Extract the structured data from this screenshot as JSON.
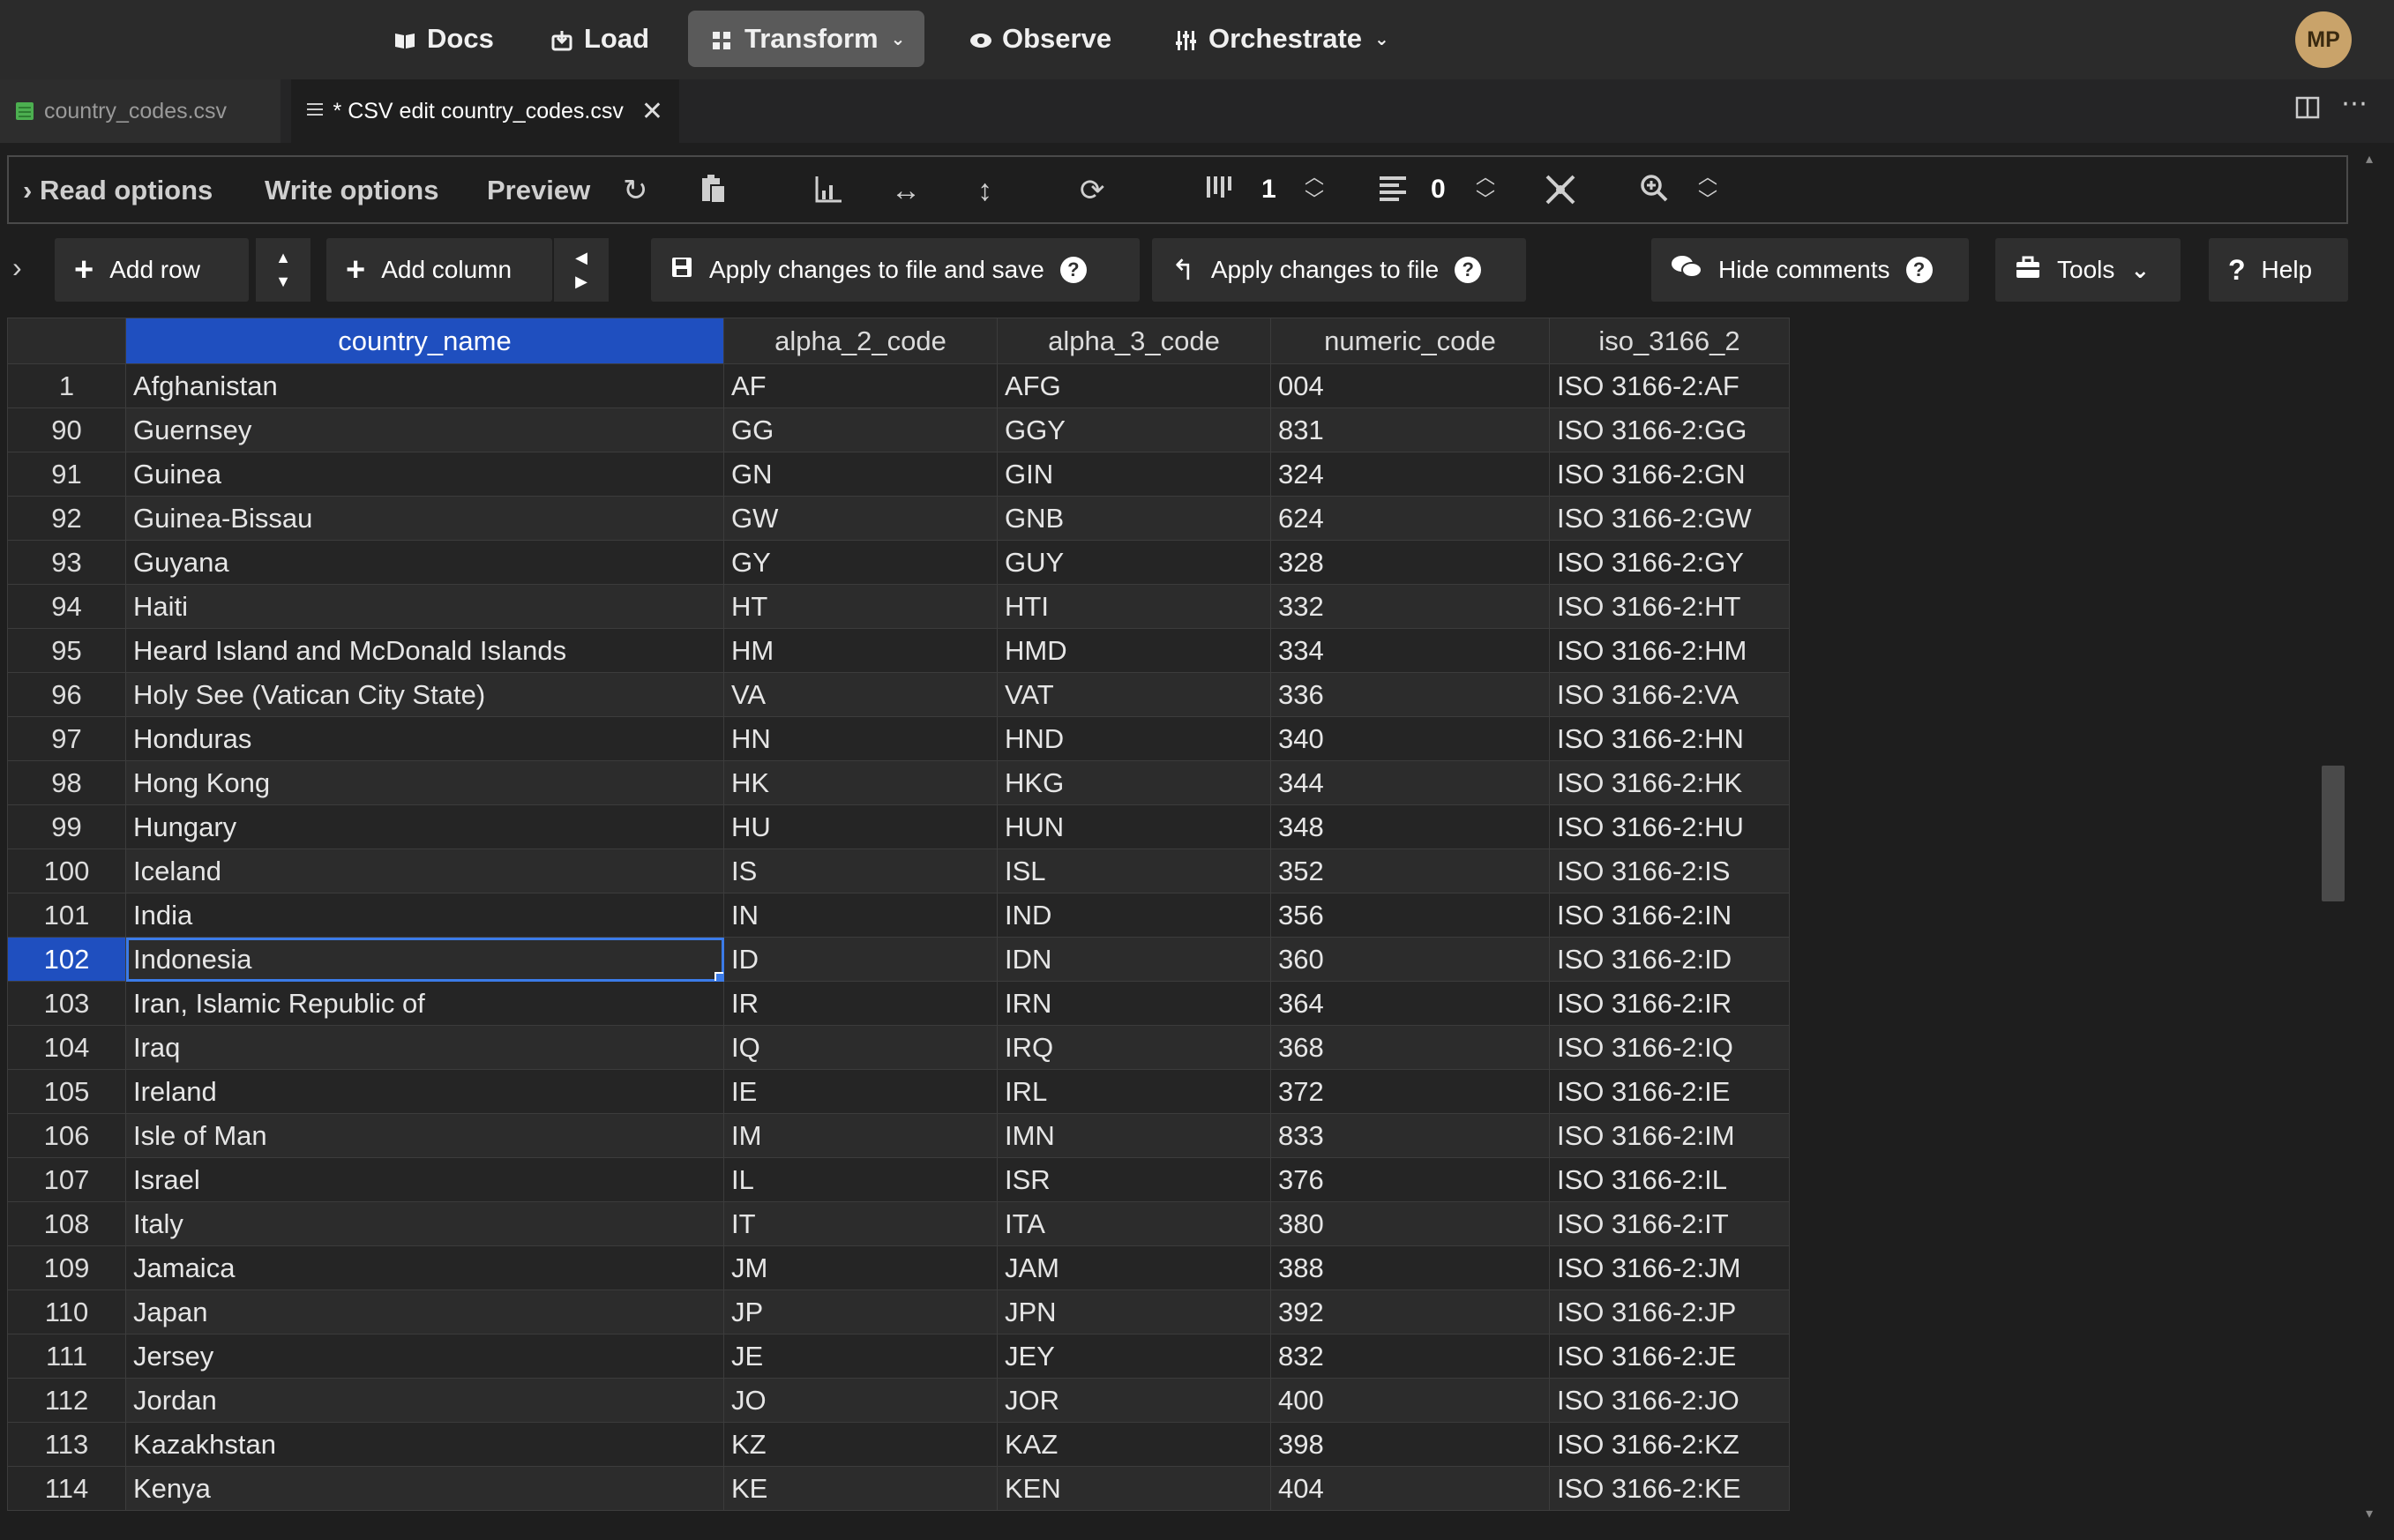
{
  "nav": {
    "items": [
      {
        "label": "Docs",
        "icon": "book-icon"
      },
      {
        "label": "Load",
        "icon": "load-icon"
      },
      {
        "label": "Transform",
        "icon": "transform-icon",
        "active": true,
        "caret": "⌄"
      },
      {
        "label": "Observe",
        "icon": "eye-icon"
      },
      {
        "label": "Orchestrate",
        "icon": "orchestrate-icon",
        "caret": "⌄"
      }
    ],
    "avatar": "MP"
  },
  "tabs": [
    {
      "label": "country_codes.csv",
      "active": false
    },
    {
      "label": "* CSV edit country_codes.csv",
      "active": true,
      "close": "✕"
    }
  ],
  "toolbar1": {
    "read_options": "Read options",
    "write_options": "Write options",
    "preview": "Preview",
    "fixed_columns_value": "1",
    "fixed_rows_value": "0"
  },
  "toolbar2": {
    "add_row": "Add row",
    "add_column": "Add column",
    "apply_save": "Apply changes to file and save",
    "apply": "Apply changes to file",
    "hide_comments": "Hide comments",
    "tools": "Tools",
    "help": "Help"
  },
  "colors": {
    "selection": "#1f4fbf",
    "accent": "#3b7be8",
    "avatar": "#c9a36a"
  },
  "table": {
    "columns": [
      "country_name",
      "alpha_2_code",
      "alpha_3_code",
      "numeric_code",
      "iso_3166_2"
    ],
    "selected_column": "country_name",
    "selected_row": "102",
    "rows": [
      [
        "1",
        "Afghanistan",
        "AF",
        "AFG",
        "004",
        "ISO 3166-2:AF"
      ],
      [
        "90",
        "Guernsey",
        "GG",
        "GGY",
        "831",
        "ISO 3166-2:GG"
      ],
      [
        "91",
        "Guinea",
        "GN",
        "GIN",
        "324",
        "ISO 3166-2:GN"
      ],
      [
        "92",
        "Guinea-Bissau",
        "GW",
        "GNB",
        "624",
        "ISO 3166-2:GW"
      ],
      [
        "93",
        "Guyana",
        "GY",
        "GUY",
        "328",
        "ISO 3166-2:GY"
      ],
      [
        "94",
        "Haiti",
        "HT",
        "HTI",
        "332",
        "ISO 3166-2:HT"
      ],
      [
        "95",
        "Heard Island and McDonald Islands",
        "HM",
        "HMD",
        "334",
        "ISO 3166-2:HM"
      ],
      [
        "96",
        "Holy See (Vatican City State)",
        "VA",
        "VAT",
        "336",
        "ISO 3166-2:VA"
      ],
      [
        "97",
        "Honduras",
        "HN",
        "HND",
        "340",
        "ISO 3166-2:HN"
      ],
      [
        "98",
        "Hong Kong",
        "HK",
        "HKG",
        "344",
        "ISO 3166-2:HK"
      ],
      [
        "99",
        "Hungary",
        "HU",
        "HUN",
        "348",
        "ISO 3166-2:HU"
      ],
      [
        "100",
        "Iceland",
        "IS",
        "ISL",
        "352",
        "ISO 3166-2:IS"
      ],
      [
        "101",
        "India",
        "IN",
        "IND",
        "356",
        "ISO 3166-2:IN"
      ],
      [
        "102",
        "Indonesia",
        "ID",
        "IDN",
        "360",
        "ISO 3166-2:ID"
      ],
      [
        "103",
        "Iran, Islamic Republic of",
        "IR",
        "IRN",
        "364",
        "ISO 3166-2:IR"
      ],
      [
        "104",
        "Iraq",
        "IQ",
        "IRQ",
        "368",
        "ISO 3166-2:IQ"
      ],
      [
        "105",
        "Ireland",
        "IE",
        "IRL",
        "372",
        "ISO 3166-2:IE"
      ],
      [
        "106",
        "Isle of Man",
        "IM",
        "IMN",
        "833",
        "ISO 3166-2:IM"
      ],
      [
        "107",
        "Israel",
        "IL",
        "ISR",
        "376",
        "ISO 3166-2:IL"
      ],
      [
        "108",
        "Italy",
        "IT",
        "ITA",
        "380",
        "ISO 3166-2:IT"
      ],
      [
        "109",
        "Jamaica",
        "JM",
        "JAM",
        "388",
        "ISO 3166-2:JM"
      ],
      [
        "110",
        "Japan",
        "JP",
        "JPN",
        "392",
        "ISO 3166-2:JP"
      ],
      [
        "111",
        "Jersey",
        "JE",
        "JEY",
        "832",
        "ISO 3166-2:JE"
      ],
      [
        "112",
        "Jordan",
        "JO",
        "JOR",
        "400",
        "ISO 3166-2:JO"
      ],
      [
        "113",
        "Kazakhstan",
        "KZ",
        "KAZ",
        "398",
        "ISO 3166-2:KZ"
      ],
      [
        "114",
        "Kenya",
        "KE",
        "KEN",
        "404",
        "ISO 3166-2:KE"
      ]
    ]
  }
}
